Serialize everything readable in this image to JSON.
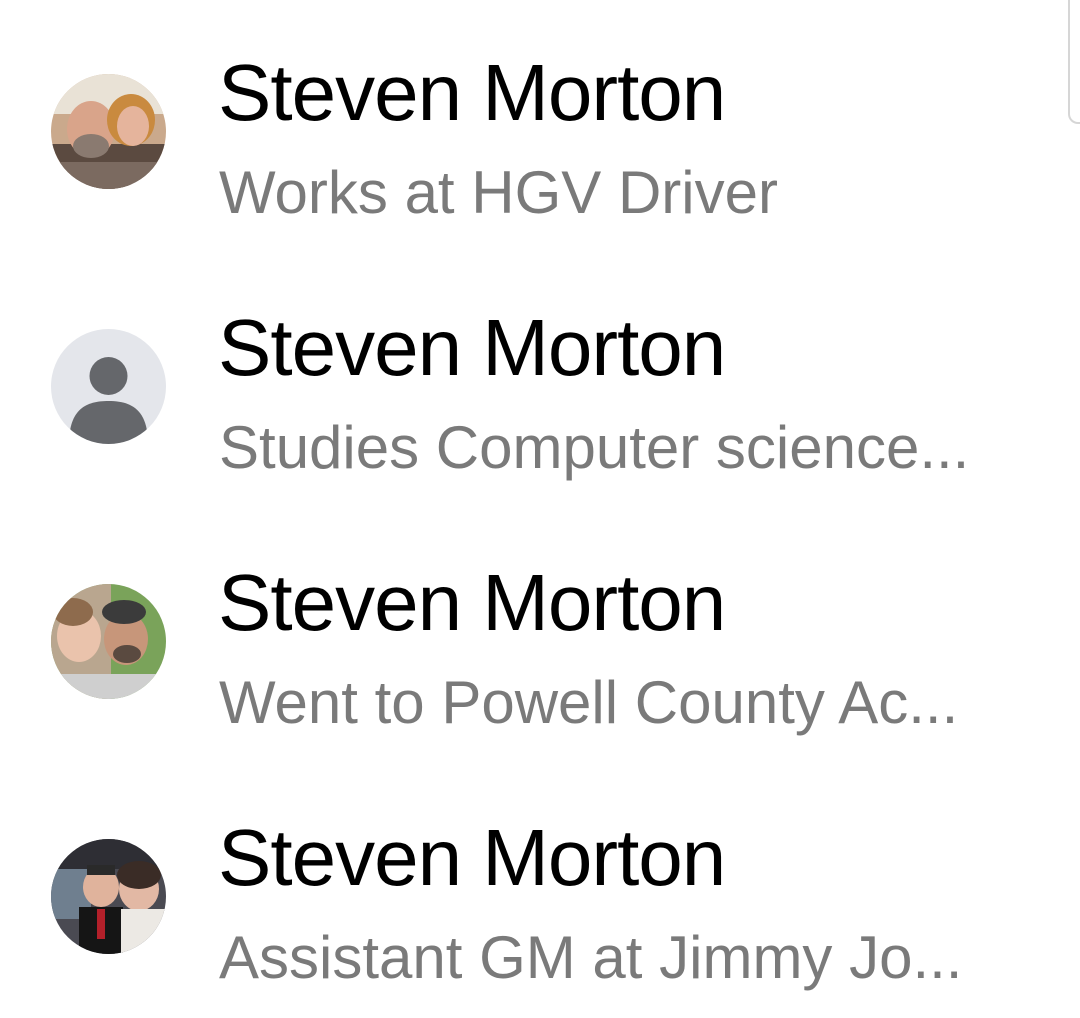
{
  "results": [
    {
      "name": "Steven Morton",
      "subtitle": "Works at HGV Driver",
      "avatar": "photo-couple-selfie"
    },
    {
      "name": "Steven Morton",
      "subtitle": "Studies Computer science...",
      "avatar": "default-person-icon"
    },
    {
      "name": "Steven Morton",
      "subtitle": "Went to Powell County Ac...",
      "avatar": "photo-father-daughter"
    },
    {
      "name": "Steven Morton",
      "subtitle": "Assistant GM at Jimmy Jo...",
      "avatar": "photo-couple-formal"
    }
  ],
  "colors": {
    "name_text": "#000000",
    "subtitle_text": "#7a7a7a",
    "default_avatar_bg": "#e4e6eb",
    "default_avatar_fg": "#65676b"
  }
}
